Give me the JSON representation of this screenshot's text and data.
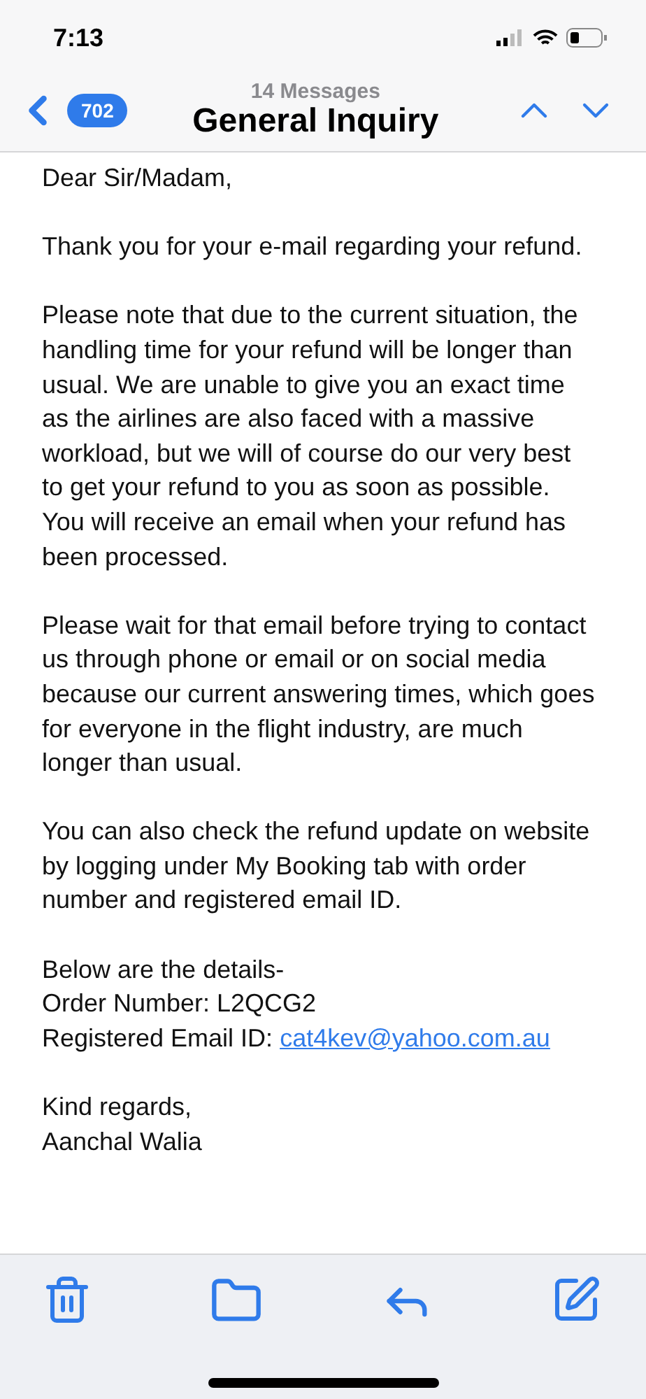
{
  "status_bar": {
    "time": "7:13"
  },
  "nav": {
    "unread_count": "702",
    "subtitle": "14 Messages",
    "title": "General Inquiry"
  },
  "body": {
    "paragraphs": [
      {
        "kind": "text",
        "lines": [
          "Dear Sir/Madam,"
        ]
      },
      {
        "kind": "text",
        "lines": [
          "Thank you for your e-mail regarding your refund."
        ]
      },
      {
        "kind": "text",
        "lines": [
          "Please note that due to the current situation, the handling time for your refund will be longer than usual. We are unable to give you an exact time as the airlines are also faced with a massive workload, but we will of course do our very best to get your refund to you as soon as possible. You will receive an email when your refund has been processed."
        ]
      },
      {
        "kind": "text",
        "lines": [
          "Please wait for that email before trying to contact us through phone or email or on social media because our current answering times, which goes for everyone in the flight industry, are much longer than usual."
        ]
      },
      {
        "kind": "text",
        "lines": [
          "You can also check the refund update on website by logging under My Booking tab with order number and registered email ID."
        ]
      },
      {
        "kind": "details",
        "lines": [
          "Below are the details-",
          "Order Number: L2QCG2"
        ],
        "link_label": "Registered Email ID: ",
        "link": "cat4kev@yahoo.com.au"
      },
      {
        "kind": "text",
        "lines": [
          "Kind regards,",
          "Aanchal Walia"
        ]
      }
    ]
  }
}
